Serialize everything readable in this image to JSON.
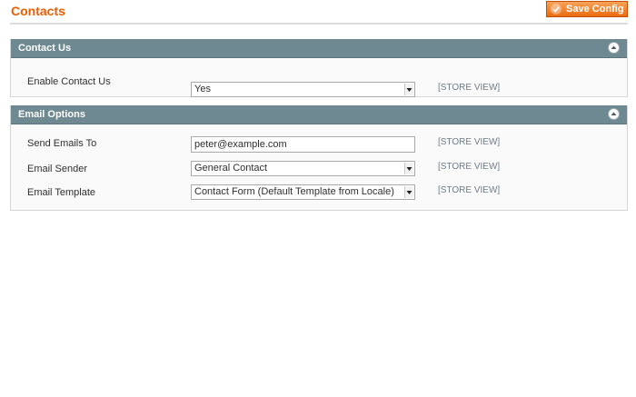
{
  "page": {
    "title": "Contacts",
    "save_label": "Save Config",
    "colors": {
      "title": "#eb5e00",
      "button": "#e96c10",
      "section_header": "#6f8992"
    }
  },
  "sections": [
    {
      "title": "Contact Us",
      "icon": "collapse-icon",
      "fields": [
        {
          "label": "Enable Contact Us",
          "type": "select",
          "value": "Yes",
          "scope": "[STORE VIEW]"
        }
      ]
    },
    {
      "title": "Email Options",
      "icon": "collapse-icon",
      "fields": [
        {
          "label": "Send Emails To",
          "type": "text",
          "value": "peter@example.com",
          "scope": "[STORE VIEW]"
        },
        {
          "label": "Email Sender",
          "type": "select",
          "value": "General Contact",
          "scope": "[STORE VIEW]"
        },
        {
          "label": "Email Template",
          "type": "select",
          "value": "Contact Form (Default Template from Locale)",
          "scope": "[STORE VIEW]"
        }
      ]
    }
  ]
}
